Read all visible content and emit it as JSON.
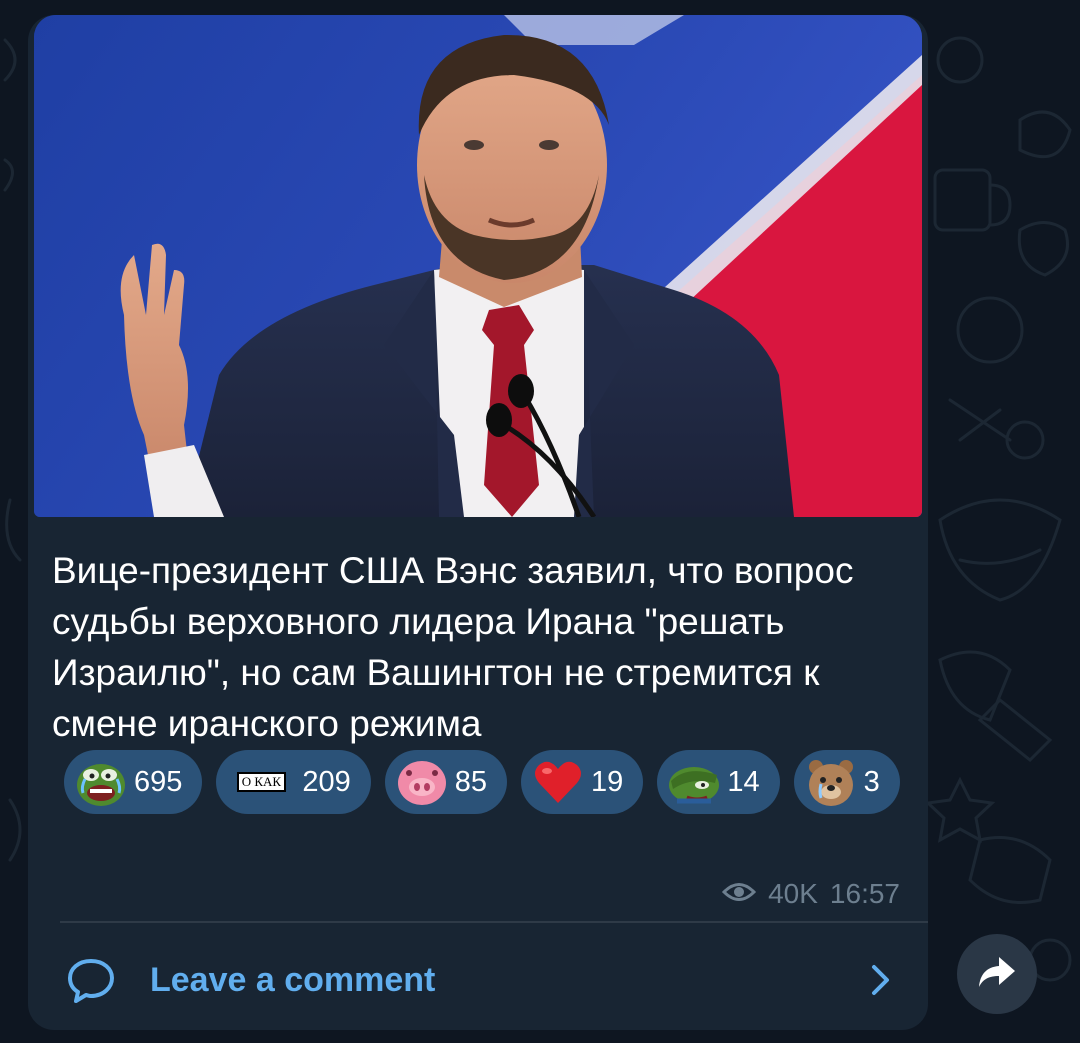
{
  "post": {
    "caption": "Вице-президент США Вэнс заявил, что вопрос судьбы верховного лидера Ирана \"решать Израилю\", но сам Вашингтон не стремится к смене иранского режима",
    "views": "40K",
    "time": "16:57"
  },
  "reactions": [
    {
      "emoji": "pepe-crying-laughing-icon",
      "count": "695"
    },
    {
      "emoji": "о как-sticker",
      "label": "О КАК",
      "count": "209"
    },
    {
      "emoji": "pig-nose-icon",
      "count": "85"
    },
    {
      "emoji": "red-heart-icon",
      "count": "19"
    },
    {
      "emoji": "pepe-facepalm-icon",
      "count": "14"
    },
    {
      "emoji": "bear-crying-icon",
      "count": "3"
    }
  ],
  "comments": {
    "label": "Leave a comment"
  },
  "colors": {
    "background": "#0e1621",
    "bubble": "#182533",
    "reaction_chip": "#2b5278",
    "link": "#61aeee",
    "meta": "#6d7f8f"
  }
}
